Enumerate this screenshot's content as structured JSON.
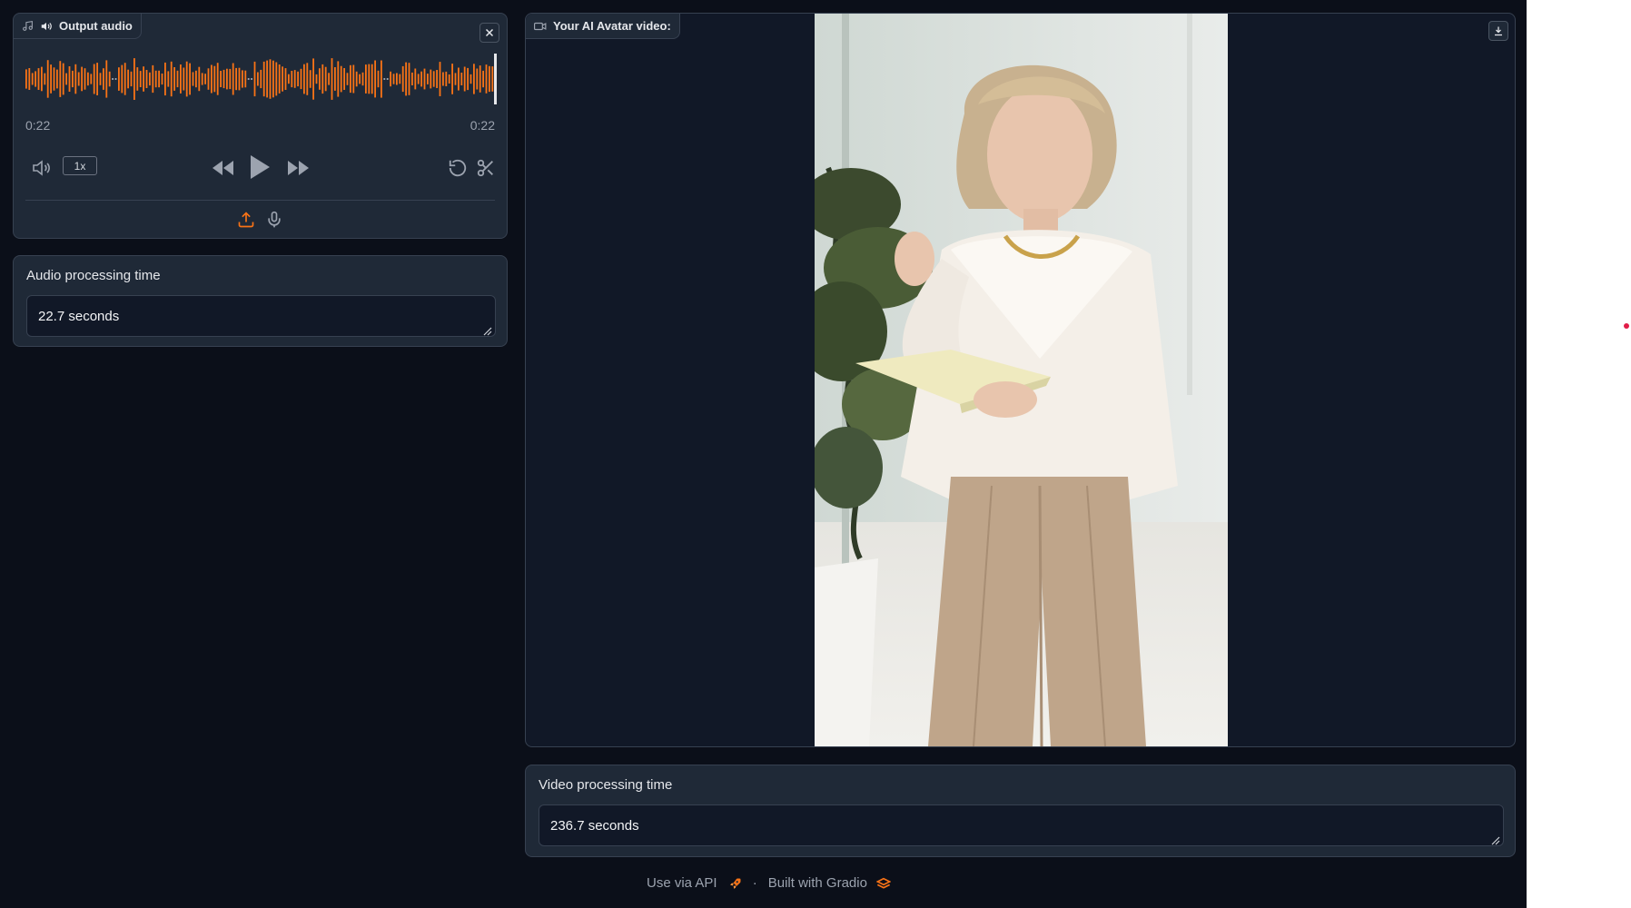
{
  "audio_player": {
    "label": "Output audio",
    "current_time": "0:22",
    "duration": "0:22",
    "playback_rate": "1x",
    "progress": 1.0
  },
  "audio_time": {
    "label": "Audio processing time",
    "value": "22.7 seconds"
  },
  "video": {
    "label": "Your AI Avatar video:"
  },
  "video_time": {
    "label": "Video processing time",
    "value": "236.7 seconds"
  },
  "footer": {
    "api_link": "Use via API",
    "separator": "·",
    "built_with": "Built with Gradio"
  },
  "colors": {
    "background": "#0b0f19",
    "panel": "#1f2937",
    "border": "#374151",
    "accent": "#f97316",
    "text": "#e5e7eb",
    "muted": "#9ca3af"
  },
  "icons": {
    "audio_block": "music-note-icon",
    "speaker": "speaker-icon",
    "close": "close-icon",
    "volume": "volume-icon",
    "rewind": "rewind-icon",
    "play": "play-icon",
    "forward": "fast-forward-icon",
    "reset": "reset-icon",
    "trim": "scissors-icon",
    "upload": "upload-icon",
    "microphone": "microphone-icon",
    "video_block": "video-camera-icon",
    "download": "download-icon",
    "api": "rocket-icon",
    "gradio": "gradio-logo-icon"
  }
}
